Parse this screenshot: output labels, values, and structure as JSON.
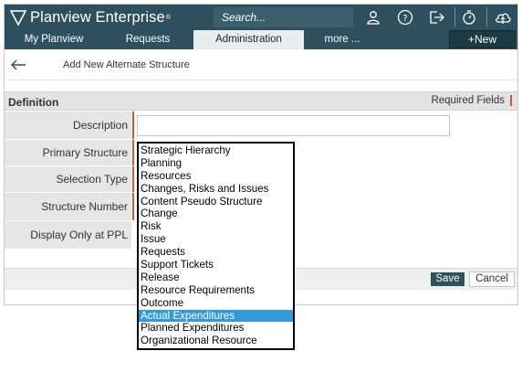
{
  "header": {
    "brand": "Planview Enterprise",
    "brand_mark": "®",
    "search_placeholder": "Search...",
    "icons": [
      "user-icon",
      "help-icon",
      "logout-icon",
      "timer-icon",
      "cloud-icon"
    ],
    "colors": {
      "bar": "#2d4f5e",
      "search": "#3d5f6d",
      "new_button": "#1d3944"
    }
  },
  "nav": {
    "tabs": [
      {
        "label": "My Planview",
        "active": false
      },
      {
        "label": "Requests",
        "active": false
      },
      {
        "label": "Administration",
        "active": true
      },
      {
        "label": "more ...",
        "active": false
      }
    ],
    "new_button": "+New"
  },
  "page": {
    "title": "Add New Alternate Structure"
  },
  "section": {
    "title": "Definition",
    "required_note": "Required Fields",
    "required_color": "#d9532c"
  },
  "form": {
    "fields": [
      {
        "label": "Description",
        "required": true,
        "value": ""
      },
      {
        "label": "Primary Structure",
        "required": true
      },
      {
        "label": "Selection Type",
        "required": true
      },
      {
        "label": "Structure Number",
        "required": true
      },
      {
        "label": "Display Only at PPL",
        "required": false
      }
    ]
  },
  "dropdown": {
    "options": [
      "Strategic Hierarchy",
      "Planning",
      "Resources",
      "Changes, Risks and Issues",
      "Content Pseudo Structure",
      "Change",
      "Risk",
      "Issue",
      "Requests",
      "Support Tickets",
      "Release",
      "Resource Requirements",
      "Outcome",
      "Actual Expenditures",
      "Planned Expenditures",
      "Organizational Resource"
    ],
    "highlighted": "Actual Expenditures",
    "highlight_color": "#3399dd"
  },
  "actions": {
    "save": "Save",
    "cancel": "Cancel"
  }
}
